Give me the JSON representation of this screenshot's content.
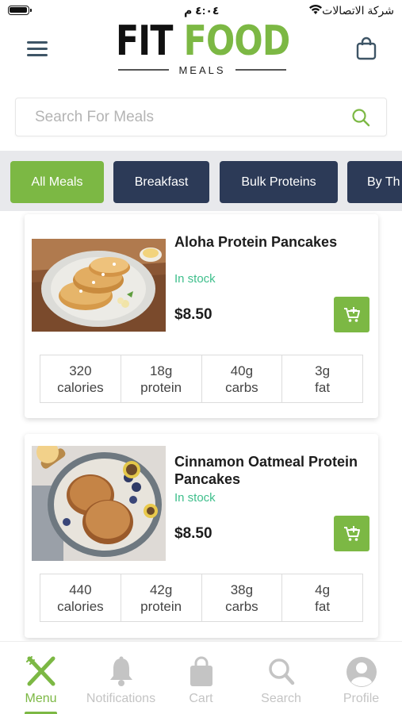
{
  "status_bar": {
    "time": "٤:٠٤ م",
    "carrier": "شركة الاتصالات"
  },
  "header": {
    "logo_word_1": "FIT",
    "logo_word_2": "FOOD",
    "logo_subtitle": "MEALS"
  },
  "search": {
    "placeholder": "Search For Meals",
    "value": ""
  },
  "categories": [
    "All Meals",
    "Breakfast",
    "Bulk Proteins",
    "By Th"
  ],
  "products": [
    {
      "name": "Aloha Protein Pancakes",
      "stock": "In stock",
      "price": "$8.50",
      "nutrition": [
        {
          "value": "320",
          "unit": "calories"
        },
        {
          "value": "18g",
          "unit": "protein"
        },
        {
          "value": "40g",
          "unit": "carbs"
        },
        {
          "value": "3g",
          "unit": "fat"
        }
      ]
    },
    {
      "name": "Cinnamon Oatmeal Protein Pancakes",
      "stock": "In stock",
      "price": "$8.50",
      "nutrition": [
        {
          "value": "440",
          "unit": "calories"
        },
        {
          "value": "42g",
          "unit": "protein"
        },
        {
          "value": "38g",
          "unit": "carbs"
        },
        {
          "value": "4g",
          "unit": "fat"
        }
      ]
    }
  ],
  "bottom_nav": [
    {
      "label": "Menu",
      "icon": "fork-knife-icon",
      "active": true
    },
    {
      "label": "Notifications",
      "icon": "bell-icon",
      "active": false
    },
    {
      "label": "Cart",
      "icon": "shopping-bag-icon",
      "active": false
    },
    {
      "label": "Search",
      "icon": "search-icon",
      "active": false
    },
    {
      "label": "Profile",
      "icon": "user-icon",
      "active": false
    }
  ],
  "colors": {
    "accent": "#7cb844",
    "tab_dark": "#2c3a57",
    "in_stock": "#3fbf8c",
    "nav_inactive": "#c4c4c4",
    "menu_icon": "#3e5566"
  }
}
